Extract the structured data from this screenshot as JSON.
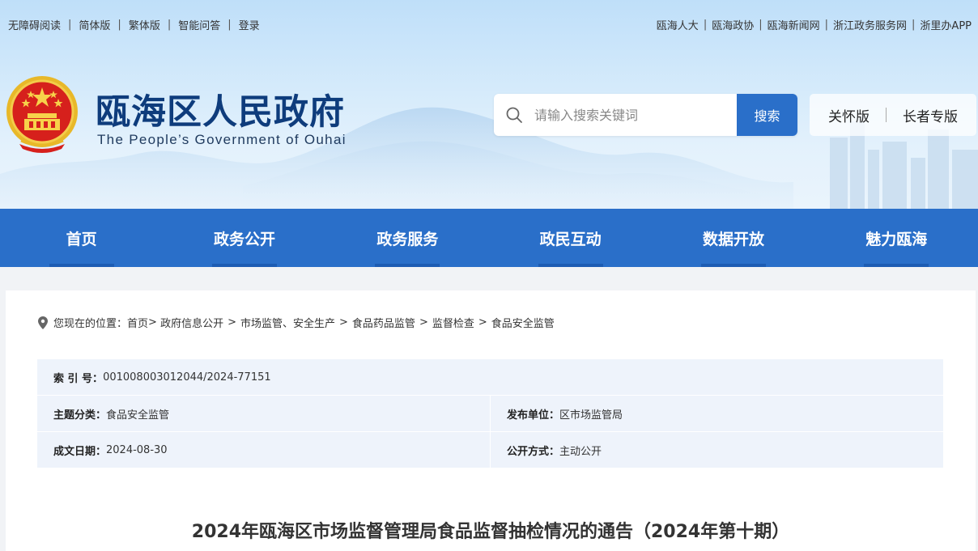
{
  "top_links_left": [
    "无障碍阅读",
    "简体版",
    "繁体版",
    "智能问答",
    "登录"
  ],
  "top_links_right": [
    "瓯海人大",
    "瓯海政协",
    "瓯海新闻网",
    "浙江政务服务网",
    "浙里办APP"
  ],
  "site": {
    "title_cn": "瓯海区人民政府",
    "title_en": "The People’s Government of Ouhai"
  },
  "search": {
    "placeholder": "请输入搜索关键词",
    "button": "搜索"
  },
  "modes": [
    "关怀版",
    "长者专版"
  ],
  "nav": [
    "首页",
    "政务公开",
    "政务服务",
    "政民互动",
    "数据开放",
    "魅力瓯海"
  ],
  "breadcrumb": {
    "prefix": "您现在的位置：",
    "items": [
      "首页",
      "政府信息公开",
      "市场监管、安全生产",
      "食品药品监管",
      "监督检查",
      "食品安全监管"
    ]
  },
  "meta": {
    "index_label": "索 引 号：",
    "index_value": "001008003012044/2024-77151",
    "topic_label": "主题分类：",
    "topic_value": "食品安全监管",
    "publisher_label": "发布单位：",
    "publisher_value": "区市场监管局",
    "date_label": "成文日期：",
    "date_value": "2024-08-30",
    "open_label": "公开方式：",
    "open_value": "主动公开"
  },
  "document_title": "2024年瓯海区市场监督管理局食品监督抽检情况的通告（2024年第十期）",
  "colors": {
    "nav_blue": "#2a6fc9",
    "title_navy": "#0e3c7c",
    "meta_bg": "#eef3fb"
  }
}
